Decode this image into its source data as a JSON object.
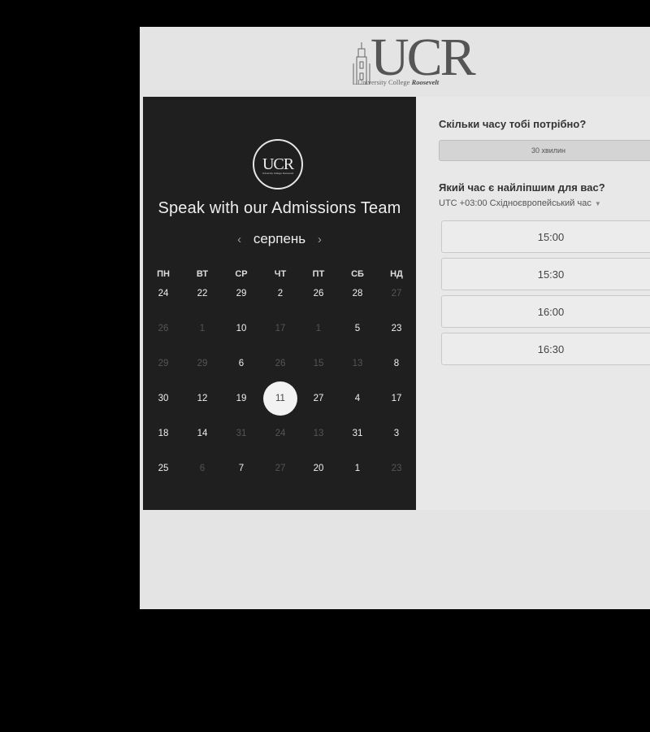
{
  "logo": {
    "text": "UCR",
    "subtitle_plain": "University College ",
    "subtitle_em": "Roosevelt"
  },
  "left_panel": {
    "badge_text": "UCR",
    "badge_subtitle": "University College Roosevelt",
    "heading": "Speak with our Admissions Team",
    "month": "серпень",
    "prev_icon": "chevron-left-icon",
    "next_icon": "chevron-right-icon",
    "weekdays": [
      "ПН",
      "ВТ",
      "СР",
      "ЧТ",
      "ПТ",
      "СБ",
      "НД"
    ],
    "weeks": [
      [
        {
          "d": "24",
          "s": "on"
        },
        {
          "d": "22",
          "s": "on"
        },
        {
          "d": "29",
          "s": "on"
        },
        {
          "d": "2",
          "s": "on"
        },
        {
          "d": "26",
          "s": "on"
        },
        {
          "d": "28",
          "s": "on"
        },
        {
          "d": "27",
          "s": "off"
        }
      ],
      [
        {
          "d": "26",
          "s": "off"
        },
        {
          "d": "1",
          "s": "off"
        },
        {
          "d": "10",
          "s": "on"
        },
        {
          "d": "17",
          "s": "off"
        },
        {
          "d": "1",
          "s": "off"
        },
        {
          "d": "5",
          "s": "on"
        },
        {
          "d": "23",
          "s": "on"
        }
      ],
      [
        {
          "d": "29",
          "s": "off"
        },
        {
          "d": "29",
          "s": "off"
        },
        {
          "d": "6",
          "s": "on"
        },
        {
          "d": "26",
          "s": "off"
        },
        {
          "d": "15",
          "s": "off"
        },
        {
          "d": "13",
          "s": "off"
        },
        {
          "d": "8",
          "s": "on"
        }
      ],
      [
        {
          "d": "30",
          "s": "on"
        },
        {
          "d": "12",
          "s": "on"
        },
        {
          "d": "19",
          "s": "on"
        },
        {
          "d": "11",
          "s": "sel"
        },
        {
          "d": "27",
          "s": "on"
        },
        {
          "d": "4",
          "s": "on"
        },
        {
          "d": "17",
          "s": "on"
        }
      ],
      [
        {
          "d": "18",
          "s": "on"
        },
        {
          "d": "14",
          "s": "on"
        },
        {
          "d": "31",
          "s": "off"
        },
        {
          "d": "24",
          "s": "off"
        },
        {
          "d": "13",
          "s": "off"
        },
        {
          "d": "31",
          "s": "on"
        },
        {
          "d": "3",
          "s": "on"
        }
      ],
      [
        {
          "d": "25",
          "s": "on"
        },
        {
          "d": "6",
          "s": "off"
        },
        {
          "d": "7",
          "s": "on"
        },
        {
          "d": "27",
          "s": "off"
        },
        {
          "d": "20",
          "s": "on"
        },
        {
          "d": "1",
          "s": "on"
        },
        {
          "d": "23",
          "s": "off"
        }
      ]
    ]
  },
  "right_panel": {
    "duration_question": "Скільки часу тобі потрібно?",
    "duration_value": "30 хвилин",
    "time_question": "Який час є найліпшим для вас?",
    "timezone": "UTC +03:00 Східноєвропейський час",
    "timezone_caret": "caret-down-icon",
    "slots": [
      "15:00",
      "15:30",
      "16:00",
      "16:30"
    ]
  }
}
